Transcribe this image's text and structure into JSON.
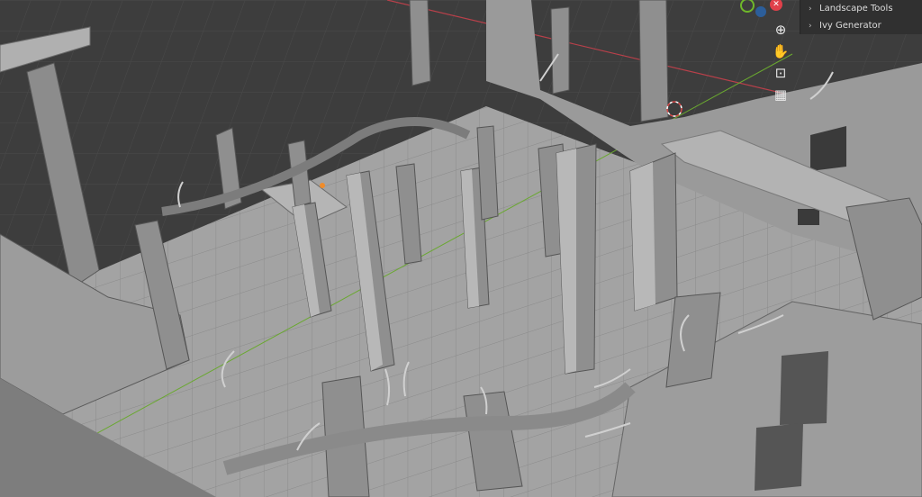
{
  "panel": {
    "items": [
      {
        "label": "Landscape Tools",
        "icon": "chevron-right-icon"
      },
      {
        "label": "Ivy Generator",
        "icon": "chevron-right-icon"
      }
    ]
  },
  "gizmo": {
    "axes": [
      {
        "name": "z-axis",
        "color": "#2c8ad8"
      },
      {
        "name": "y-axis",
        "color": "#6fb82a"
      },
      {
        "name": "x-axis",
        "color": "#e0404a"
      }
    ]
  },
  "nav_tools": [
    {
      "name": "zoom-icon",
      "glyph": "⊕"
    },
    {
      "name": "pan-hand-icon",
      "glyph": "✋"
    },
    {
      "name": "camera-icon",
      "glyph": "⊡"
    },
    {
      "name": "grid-icon",
      "glyph": "▦"
    }
  ],
  "colors": {
    "background": "#3d3d3d",
    "floor": "#9e9e9e",
    "x_axis_line": "#c0404a",
    "y_axis_line": "#6fb82a",
    "object": "#8e8e8e"
  }
}
